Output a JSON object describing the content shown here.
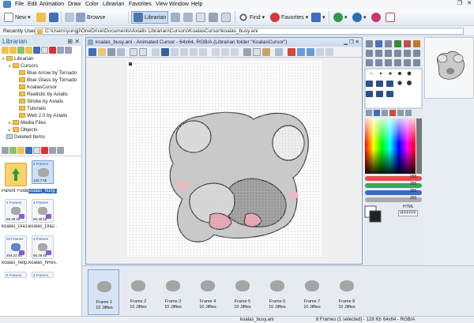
{
  "menu": [
    "File",
    "Edit",
    "Animation",
    "Draw",
    "Color",
    "Librarian",
    "Favorites",
    "View",
    "Window",
    "Help"
  ],
  "toolbar": {
    "new_label": "New",
    "browse_label": "Browse",
    "librarian_label": "Librarian",
    "find_label": "Find",
    "favorites_label": "Favorites"
  },
  "address": {
    "label": "Recently Used",
    "path": "C:\\Users\\yungji\\OneDrive\\Documents\\Axialis Librarian\\Cursors\\KoalasCursor\\koalas_busy.ani"
  },
  "librarian": {
    "title": "Librarian",
    "tree": [
      {
        "label": "Librarian",
        "level": 0,
        "expanded": true
      },
      {
        "label": "Cursors",
        "level": 1,
        "expanded": true
      },
      {
        "label": "Blue Arrow by Tornado",
        "level": 2
      },
      {
        "label": "Blue Glass by Tornado",
        "level": 2
      },
      {
        "label": "KoalasCursor",
        "level": 2
      },
      {
        "label": "Realistic by Axialis",
        "level": 2
      },
      {
        "label": "Stroke by Axialis",
        "level": 2
      },
      {
        "label": "Tutorials",
        "level": 2
      },
      {
        "label": "Web 2.0 by Axialis",
        "level": 2
      },
      {
        "label": "Media Files",
        "level": 1
      },
      {
        "label": "Objects",
        "level": 1
      },
      {
        "label": "Deleted Items",
        "level": 0
      }
    ],
    "thumbnails": [
      {
        "caption": "Parent Folder",
        "tag": "",
        "size": ""
      },
      {
        "caption": "koalas_busy...",
        "tag": "8 Frames",
        "size": "132.7 kb"
      },
      {
        "caption": "koalas_Dia1...",
        "tag": "4 Frames",
        "size": "66.39 kb"
      },
      {
        "caption": "koalas_Dia2...",
        "tag": "4 Frames",
        "size": "66.39 kb"
      },
      {
        "caption": "koalas_help...",
        "tag": "28 Frames",
        "size": "464.22 kb"
      },
      {
        "caption": "koalas_hRes...",
        "tag": "4 Frames",
        "size": "66.39 kb"
      },
      {
        "caption": "",
        "tag": "5 Frames",
        "size": ""
      },
      {
        "caption": "",
        "tag": "4 Frames",
        "size": ""
      }
    ]
  },
  "editor": {
    "title": "koalas_busy.ani - Animated Cursor - 64x64, RGB/A (Librarian folder \"KoalasCursor\")"
  },
  "frames": [
    {
      "name": "Frame 1",
      "dur": "10 Jiffies"
    },
    {
      "name": "Frame 2",
      "dur": "10 Jiffies"
    },
    {
      "name": "Frame 3",
      "dur": "10 Jiffies"
    },
    {
      "name": "Frame 4",
      "dur": "10 Jiffies"
    },
    {
      "name": "Frame 5",
      "dur": "10 Jiffies"
    },
    {
      "name": "Frame 6",
      "dur": "10 Jiffies"
    },
    {
      "name": "Frame 7",
      "dur": "10 Jiffies"
    },
    {
      "name": "Frame 8",
      "dur": "10 Jiffies"
    }
  ],
  "color_panel": {
    "values": [
      "255",
      "255",
      "255",
      "255"
    ],
    "html_label": "HTML",
    "html_value": "#FFFFFF"
  },
  "status": {
    "file": "koalas_busy.ani",
    "frames": "8 Frames (1 selected) - 128 Kb",
    "format": "64x64 - RGB/A"
  },
  "colors": {
    "accent": "#2d6cb5",
    "folder": "#f0c14b",
    "koala_gray": "#9a9a9a",
    "koala_pink": "#e9a3b0"
  }
}
